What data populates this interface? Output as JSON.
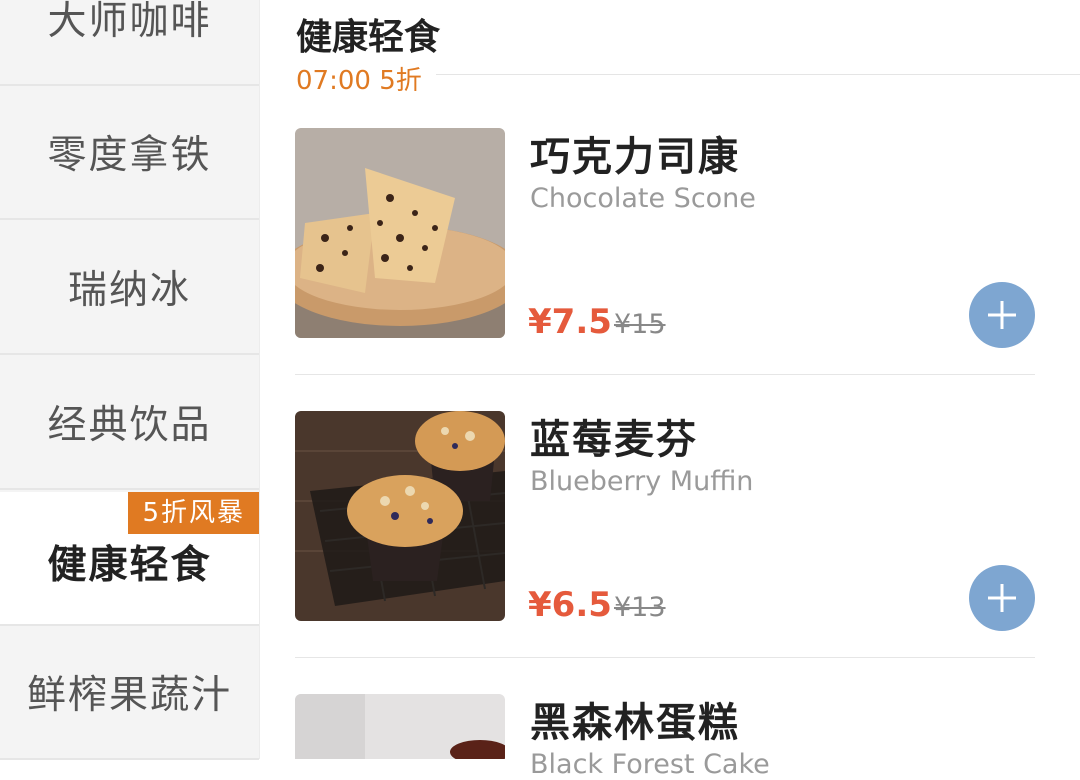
{
  "sidebar": {
    "items": [
      {
        "label": "大师咖啡"
      },
      {
        "label": "零度拿铁"
      },
      {
        "label": "瑞纳冰"
      },
      {
        "label": "经典饮品"
      },
      {
        "label": "健康轻食",
        "badge": "5折风暴",
        "active": true
      },
      {
        "label": "鲜榨果蔬汁"
      }
    ]
  },
  "section": {
    "title": "健康轻食",
    "subtitle": "07:00 5折"
  },
  "products": [
    {
      "name": "巧克力司康",
      "name_en": "Chocolate Scone",
      "price": "¥7.5",
      "original_price": "¥15",
      "image_icon": "scone-photo"
    },
    {
      "name": "蓝莓麦芬",
      "name_en": "Blueberry Muffin",
      "price": "¥6.5",
      "original_price": "¥13",
      "image_icon": "muffin-photo"
    },
    {
      "name": "黑森林蛋糕",
      "name_en": "Black Forest Cake",
      "image_icon": "cake-photo"
    }
  ],
  "colors": {
    "accent": "#e07a22",
    "price": "#e55a3c",
    "add_button": "#7ea6d1",
    "sidebar_bg": "#f4f4f4"
  }
}
